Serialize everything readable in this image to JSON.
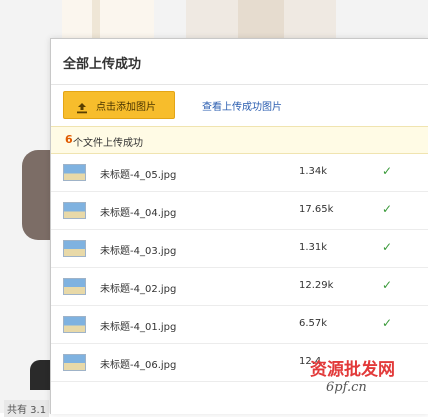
{
  "dialog": {
    "title": "全部上传成功",
    "add_button_label": "点击添加图片",
    "view_link": "查看上传成功图片",
    "status_count": "6",
    "status_text": "个文件上传成功"
  },
  "files": [
    {
      "name": "未标题-4_05.jpg",
      "size": "1.34k",
      "check": "✓"
    },
    {
      "name": "未标题-4_04.jpg",
      "size": "17.65k",
      "check": "✓"
    },
    {
      "name": "未标题-4_03.jpg",
      "size": "1.31k",
      "check": "✓"
    },
    {
      "name": "未标题-4_02.jpg",
      "size": "12.29k",
      "check": "✓"
    },
    {
      "name": "未标题-4_01.jpg",
      "size": "6.57k",
      "check": "✓"
    },
    {
      "name": "未标题-4_06.jpg",
      "size": "12.4",
      "check": ""
    }
  ],
  "background": {
    "footer_text": "共有 3.1"
  },
  "watermark": {
    "line1": "资源批发网",
    "line2": "6pf.cn"
  },
  "colors": {
    "button_yellow": "#f7bd2c",
    "count_orange": "#e05a00",
    "check_green": "#3a9a3a",
    "link_blue": "#2a5db0"
  }
}
